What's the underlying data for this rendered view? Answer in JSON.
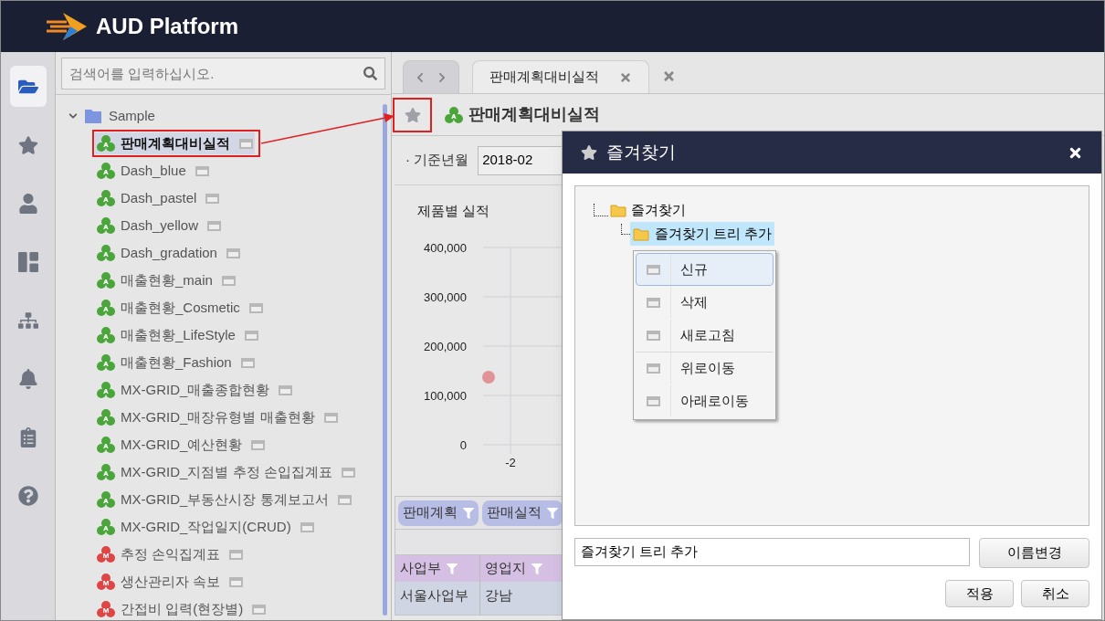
{
  "header": {
    "logo_text": "AUD Platform"
  },
  "rail": [
    {
      "selected": true
    },
    {
      "selected": false
    },
    {
      "selected": false
    },
    {
      "selected": false
    },
    {
      "selected": false
    },
    {
      "selected": false
    },
    {
      "selected": false
    },
    {
      "selected": false
    }
  ],
  "search": {
    "placeholder": "검색어를 입력하십시오."
  },
  "tree": [
    {
      "label": "Sample",
      "expanded": true,
      "children": [
        {
          "label": "판매계획대비실적",
          "kind": "a",
          "icon_text": "A",
          "selected": true
        },
        {
          "label": "Dash_blue",
          "kind": "a",
          "icon_text": "A",
          "selected": false
        },
        {
          "label": "Dash_pastel",
          "kind": "a",
          "icon_text": "A",
          "selected": false
        },
        {
          "label": "Dash_yellow",
          "kind": "a",
          "icon_text": "A",
          "selected": false
        },
        {
          "label": "Dash_gradation",
          "kind": "a",
          "icon_text": "A",
          "selected": false
        },
        {
          "label": "매출현황_main",
          "kind": "a",
          "icon_text": "A",
          "selected": false
        },
        {
          "label": "매출현황_Cosmetic",
          "kind": "a",
          "icon_text": "A",
          "selected": false
        },
        {
          "label": "매출현황_LifeStyle",
          "kind": "a",
          "icon_text": "A",
          "selected": false
        },
        {
          "label": "매출현황_Fashion",
          "kind": "a",
          "icon_text": "A",
          "selected": false
        },
        {
          "label": "MX-GRID_매출종합현황",
          "kind": "a",
          "icon_text": "A",
          "selected": false
        },
        {
          "label": "MX-GRID_매장유형별 매출현황",
          "kind": "a",
          "icon_text": "A",
          "selected": false
        },
        {
          "label": "MX-GRID_예산현황",
          "kind": "a",
          "icon_text": "A",
          "selected": false
        },
        {
          "label": "MX-GRID_지점별 추정 손입집계표",
          "kind": "a",
          "icon_text": "A",
          "selected": false
        },
        {
          "label": "MX-GRID_부동산시장 통계보고서",
          "kind": "a",
          "icon_text": "A",
          "selected": false
        },
        {
          "label": "MX-GRID_작업일지(CRUD)",
          "kind": "a",
          "icon_text": "A",
          "selected": false
        },
        {
          "label": "추정 손익집계표",
          "kind": "m",
          "icon_text": "M",
          "selected": false
        },
        {
          "label": "생산관리자 속보",
          "kind": "m",
          "icon_text": "M",
          "selected": false
        },
        {
          "label": "간접비 입력(현장별)",
          "kind": "m",
          "icon_text": "M",
          "selected": false
        }
      ]
    }
  ],
  "tabs": [
    {
      "label": "판매계획대비실적",
      "selected": true
    }
  ],
  "report": {
    "title": "판매계획대비실적",
    "title_icon_text": "A",
    "favorite": false,
    "filter_label": "· 기준년월",
    "filter_value": "2018-02",
    "chart_title": "제품별 실적",
    "y_axis_labels": [
      "400,000",
      "300,000",
      "200,000",
      "100,000",
      "0"
    ],
    "x_axis_labels": [
      "-2"
    ],
    "pills": [
      "판매계획",
      "판매실적"
    ],
    "columns": [
      "사업부",
      "영업지"
    ],
    "rows": [
      [
        "서울사업부",
        "강남"
      ]
    ]
  },
  "dialog": {
    "title": "즐겨찾기",
    "tree": [
      {
        "label": "즐겨찾기",
        "selected": false,
        "children": [
          {
            "label": "즐겨찾기 트리 추가",
            "selected": true
          }
        ]
      }
    ],
    "menu": [
      {
        "label": "신규",
        "highlighted": true,
        "divider_above": false
      },
      {
        "label": "삭제",
        "highlighted": false,
        "divider_above": false
      },
      {
        "label": "새로고침",
        "highlighted": false,
        "divider_above": false
      },
      {
        "label": "위로이동",
        "highlighted": false,
        "divider_above": true
      },
      {
        "label": "아래로이동",
        "highlighted": false,
        "divider_above": false
      }
    ],
    "name_value": "즐겨찾기 트리 추가",
    "rename_button": "이름변경",
    "buttons": [
      "적용",
      "취소"
    ]
  }
}
